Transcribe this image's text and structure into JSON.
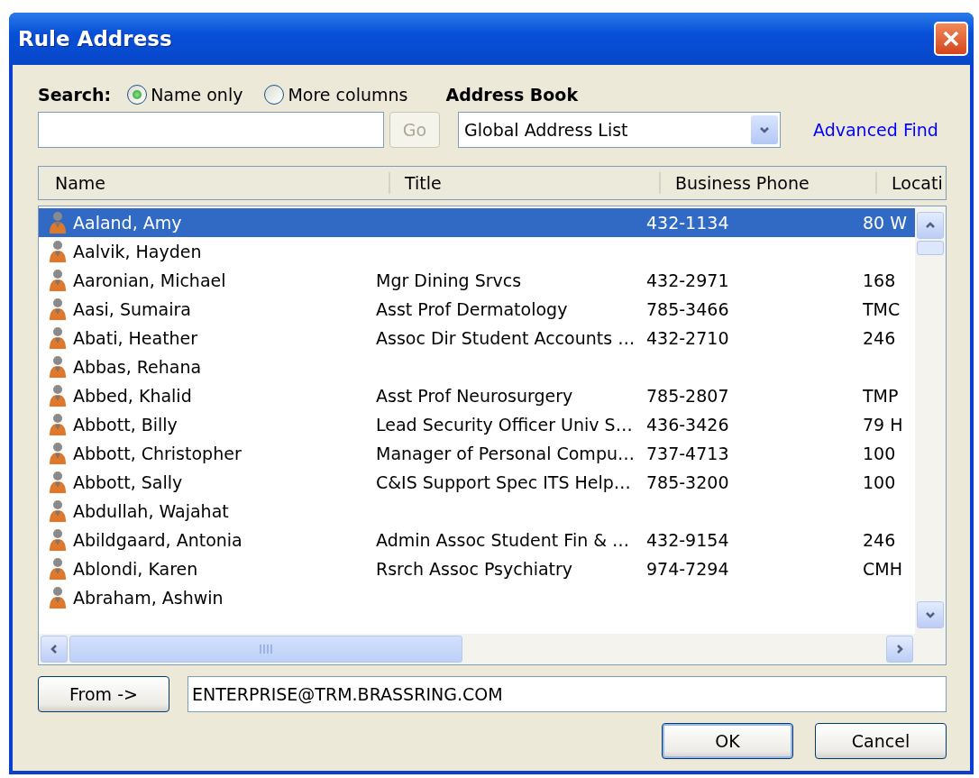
{
  "window": {
    "title": "Rule Address"
  },
  "search": {
    "label": "Search:",
    "options": [
      {
        "label": "Name only",
        "selected": true
      },
      {
        "label": "More columns",
        "selected": false
      }
    ],
    "go_button": {
      "label": "Go",
      "disabled": true
    }
  },
  "address_book": {
    "label": "Address Book",
    "value": "Global Address List",
    "advanced_find": "Advanced Find"
  },
  "table": {
    "columns": [
      "Name",
      "Title",
      "Business Phone",
      "Locati"
    ],
    "rows": [
      {
        "name": "Aaland, Amy",
        "phone": "432-1134",
        "location": "80 W",
        "selected": true
      },
      {
        "name": "Aalvik, Hayden",
        "selected": false
      },
      {
        "name": "Aaronian, Michael",
        "title": "Mgr Dining Srvcs",
        "phone": "432-2971",
        "location": "168",
        "selected": false
      },
      {
        "name": "Aasi, Sumaira",
        "title": "Asst Prof Dermatology",
        "phone": "785-3466",
        "location": "TMC",
        "selected": false
      },
      {
        "name": "Abati, Heather",
        "title": "Assoc Dir Student Accounts …",
        "phone": "432-2710",
        "location": "246",
        "selected": false
      },
      {
        "name": "Abbas, Rehana",
        "selected": false
      },
      {
        "name": "Abbed, Khalid",
        "title": "Asst Prof Neurosurgery",
        "phone": "785-2807",
        "location": "TMP",
        "selected": false
      },
      {
        "name": "Abbott, Billy",
        "title": "Lead Security Officer Univ S…",
        "phone": "436-3426",
        "location": "79 H",
        "selected": false
      },
      {
        "name": "Abbott, Christopher",
        "title": "Manager of Personal Compu…",
        "phone": "737-4713",
        "location": "100",
        "selected": false
      },
      {
        "name": "Abbott, Sally",
        "title": "C&IS Support Spec ITS Help…",
        "phone": "785-3200",
        "location": "100",
        "selected": false
      },
      {
        "name": "Abdullah, Wajahat",
        "selected": false
      },
      {
        "name": "Abildgaard, Antonia",
        "title": "Admin Assoc Student Fin & …",
        "phone": "432-9154",
        "location": "246",
        "selected": false
      },
      {
        "name": "Ablondi, Karen",
        "title": "Rsrch Assoc Psychiatry",
        "phone": "974-7294",
        "location": "CMH",
        "selected": false
      },
      {
        "name": "Abraham, Ashwin",
        "selected": false
      }
    ]
  },
  "from_button": "From ->",
  "from_value": "ENTERPRISE@TRM.BRASSRING.COM",
  "buttons": [
    "OK",
    "Cancel"
  ]
}
